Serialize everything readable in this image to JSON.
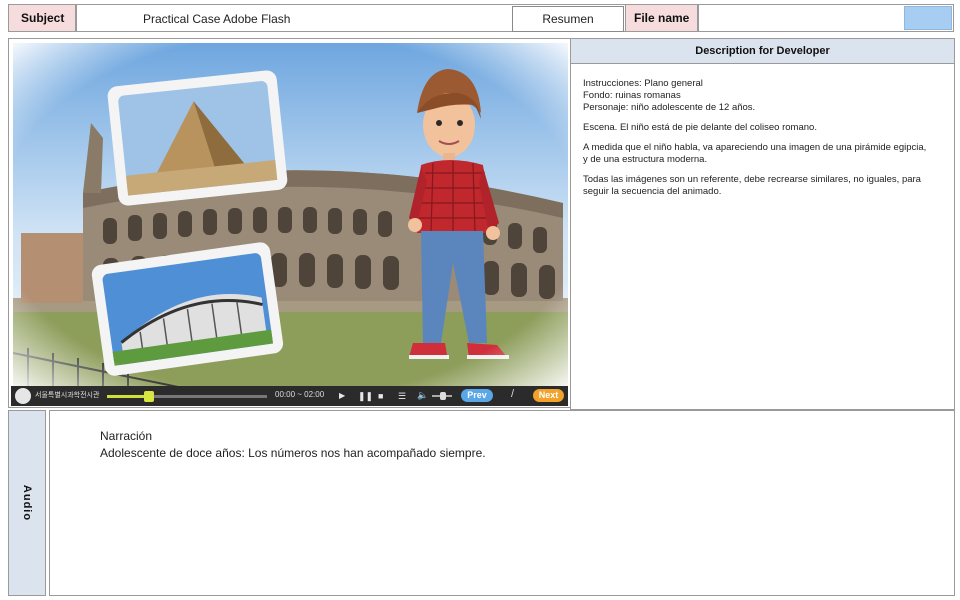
{
  "header": {
    "subject_label": "Subject",
    "subject_value": "Practical Case Adobe Flash",
    "resumen_button": "Resumen",
    "file_name_label": "File name",
    "file_name_value": ""
  },
  "description": {
    "title": "Description for Developer",
    "lines": [
      "Instrucciones: Plano general",
      "Fondo: ruinas romanas",
      "Personaje: niño adolescente de 12 años."
    ],
    "paragraph_scene": "Escena. El niño está de pie delante del coliseo romano.",
    "paragraph_images": "A medida que el niño habla, va apareciendo una imagen de una pirámide egipcia, y de una estructura moderna.",
    "paragraph_note": "Todas las imágenes son un referente, debe recrearse similares, no iguales, para seguir la secuencia del animado."
  },
  "player": {
    "org_name": "서울특별시과학전시관",
    "time": "00:00 ~ 02:00",
    "prev": "Prev",
    "separator": "/",
    "next": "Next",
    "progress": 0.26
  },
  "audio": {
    "side_label": "Audio",
    "heading": "Narración",
    "text": "Adolescente de doce años: Los números nos han acompañado siempre."
  },
  "colors": {
    "pink_label": "#f6dcdc",
    "panel_header": "#dbe3ef",
    "blue_button": "#a8cdf3",
    "player_bg": "#2b2b2b",
    "next_orange": "#f2a12b",
    "prev_blue": "#5aa7e8"
  }
}
